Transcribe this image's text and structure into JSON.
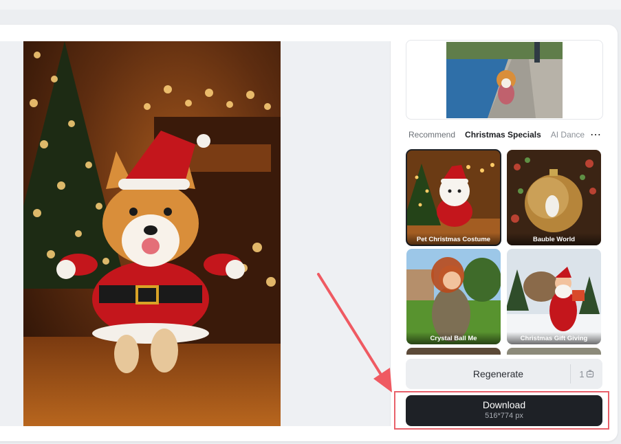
{
  "panel": {
    "style_tabs": [
      "Recommend",
      "Christmas Specials",
      "AI Dance"
    ],
    "active_tab": "Christmas Specials",
    "templates": [
      {
        "label": "Pet Christmas Costume",
        "selected": true
      },
      {
        "label": "Bauble World",
        "selected": false
      },
      {
        "label": "Crystal Ball Me",
        "selected": false
      },
      {
        "label": "Christmas Gift Giving",
        "selected": false
      }
    ]
  },
  "actions": {
    "regenerate_label": "Regenerate",
    "regenerate_count": "1",
    "download_label": "Download",
    "download_size": "516*774 px"
  },
  "colors": {
    "download_bg": "#1e2126",
    "highlight": "#e8606a",
    "arrow": "#ef5a62"
  },
  "icons": [
    "more-icon",
    "credit-icon",
    "arrow-annotation"
  ]
}
